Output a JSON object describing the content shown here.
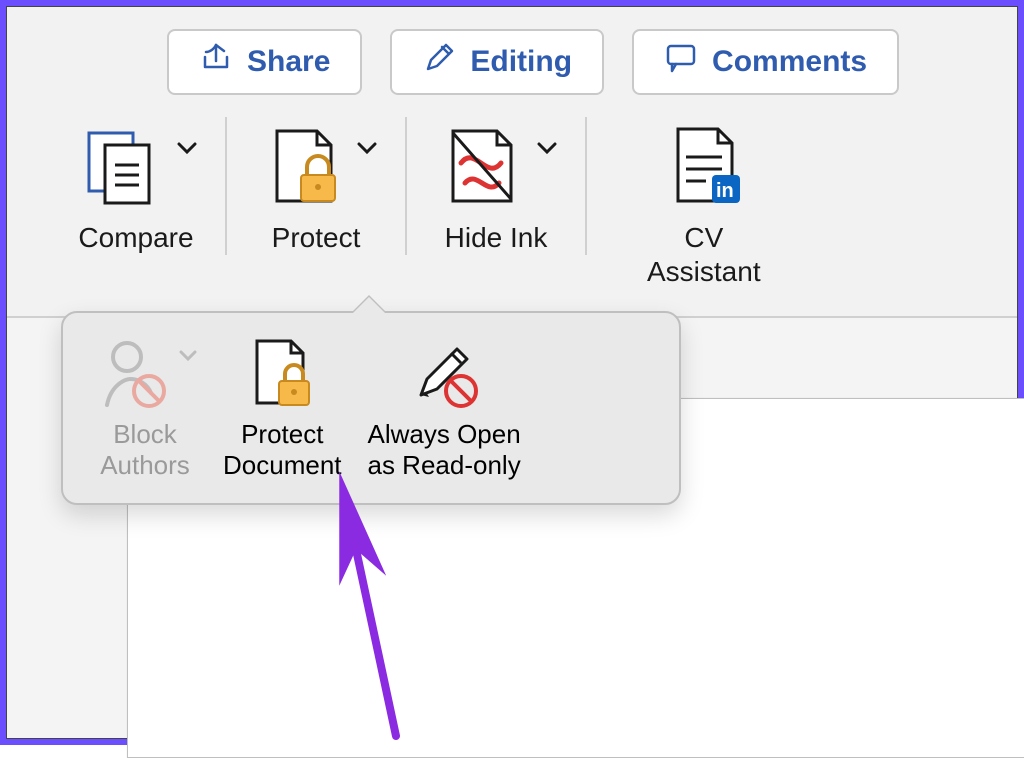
{
  "header": {
    "share_label": "Share",
    "editing_label": "Editing",
    "comments_label": "Comments"
  },
  "ribbon": {
    "compare_label": "Compare",
    "protect_label": "Protect",
    "hideink_label": "Hide Ink",
    "cv_label": "CV\nAssistant"
  },
  "protect_menu": {
    "block_authors_label": "Block\nAuthors",
    "protect_document_label": "Protect\nDocument",
    "always_readonly_label": "Always Open\nas Read-only"
  },
  "icons": {
    "share": "share-icon",
    "pencil": "pencil-icon",
    "comment": "comment-icon",
    "compare": "compare-icon",
    "lock": "lock-icon",
    "ink": "ink-icon",
    "linkedin": "linkedin-icon",
    "person_block": "person-block-icon",
    "pencil_block": "pencil-block-icon",
    "chevron": "chevron-down-icon"
  },
  "colors": {
    "accent": "#2f5cae",
    "annotation": "#8a2be2"
  }
}
